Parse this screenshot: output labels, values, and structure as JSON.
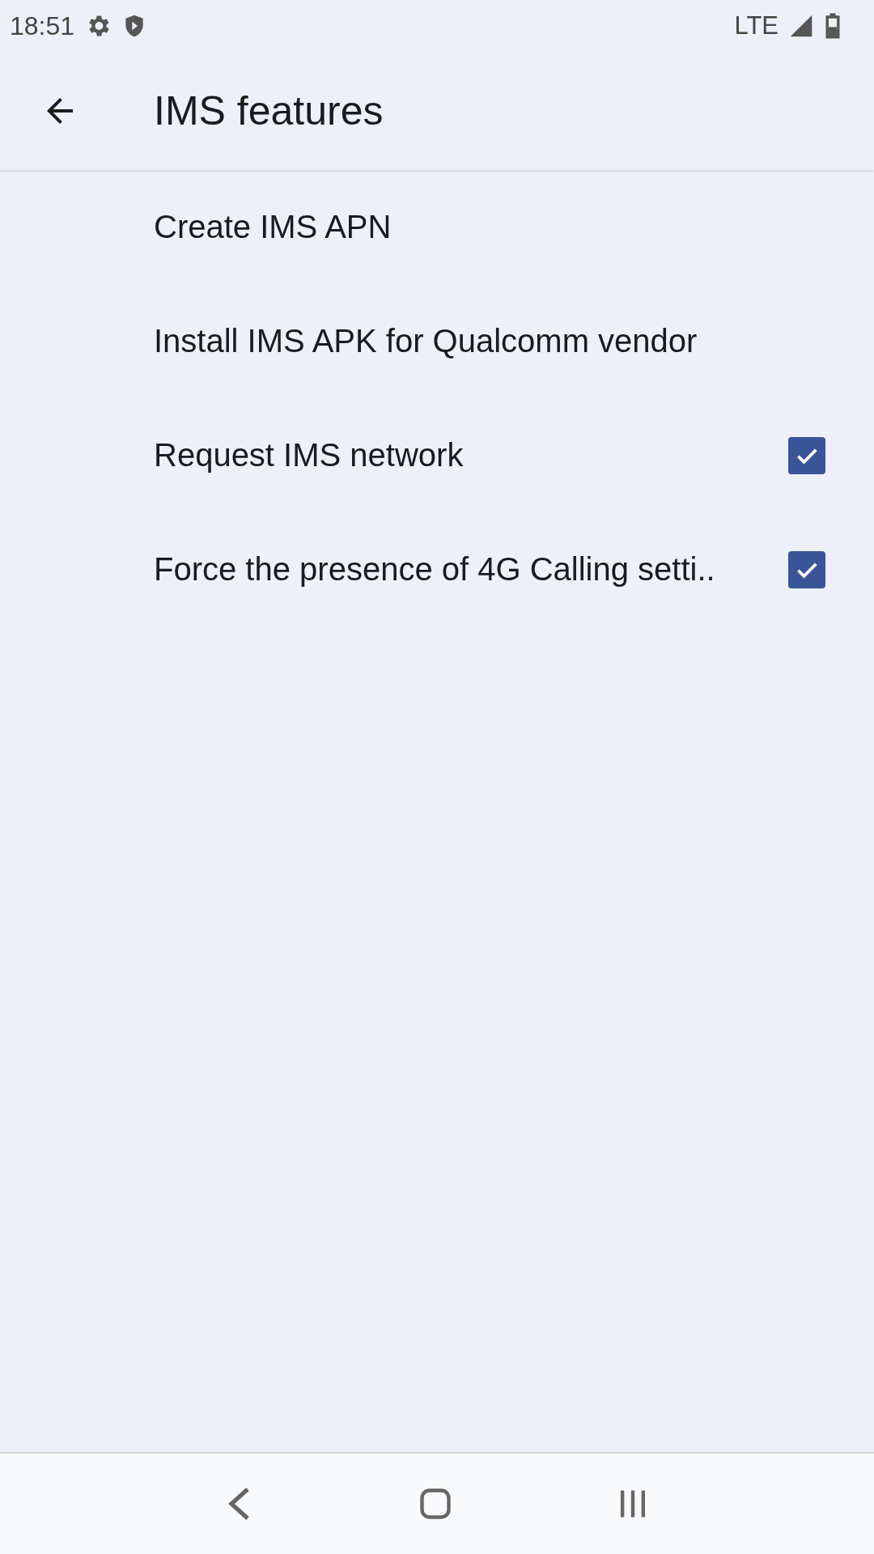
{
  "status_bar": {
    "time": "18:51",
    "network": "LTE"
  },
  "app_bar": {
    "title": "IMS features"
  },
  "items": [
    {
      "kind": "action",
      "label": "Create IMS APN"
    },
    {
      "kind": "action",
      "label": "Install IMS APK for Qualcomm vendor"
    },
    {
      "kind": "checkbox",
      "label": "Request IMS network",
      "checked": true
    },
    {
      "kind": "checkbox",
      "label": "Force the presence of 4G Calling setti..",
      "checked": true
    }
  ]
}
